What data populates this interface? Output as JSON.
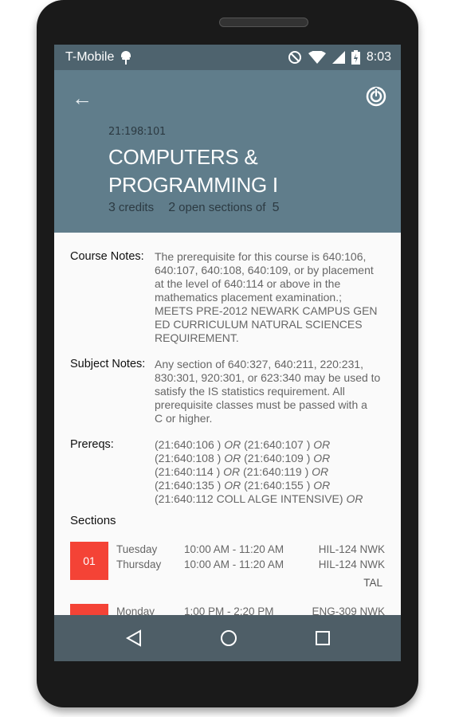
{
  "status_bar": {
    "carrier": "T-Mobile",
    "time": "8:03"
  },
  "header": {
    "course_code": "21:198:101",
    "title_lines": [
      "COMPUTERS &",
      "PROGRAMMING I"
    ],
    "credits": "3",
    "credits_label": "credits",
    "open_sections": "2",
    "open_label": "open sections of",
    "total_sections": "5",
    "color": "#607d8b"
  },
  "notes": {
    "course_label": "Course Notes:",
    "course_lines": [
      "The prerequisite for this course is 640:106,",
      "640:107, 640:108, 640:109, or by placement",
      "at the level of 640:114 or above in the",
      "mathematics placement examination.;",
      "MEETS PRE-2012 NEWARK CAMPUS GEN",
      "ED CURRICULUM NATURAL SCIENCES",
      "REQUIREMENT."
    ],
    "subject_label": "Subject Notes:",
    "subject_lines": [
      "Any section of 640:327, 640:211, 220:231,",
      "830:301, 920:301, or 623:340 may be used to",
      "satisfy the IS statistics requirement. All",
      "prerequisite classes must be passed with a",
      "C or higher."
    ],
    "prereqs_label": "Prereqs:",
    "prereq_lines": [
      [
        "(21:640:106 )",
        "OR",
        "(21:640:107 )",
        "OR"
      ],
      [
        "(21:640:108 )",
        "OR",
        "(21:640:109 )",
        "OR"
      ],
      [
        "(21:640:114 )",
        "OR",
        "(21:640:119 )",
        "OR"
      ],
      [
        "(21:640:135 )",
        "OR",
        "(21:640:155 )",
        "OR"
      ],
      [
        "(21:640:112 COLL ALGE INTENSIVE)",
        "OR",
        "",
        ""
      ]
    ]
  },
  "sections": {
    "heading": "Sections",
    "items": [
      {
        "number": "01",
        "meetings": [
          {
            "day": "Tuesday",
            "time": "10:00 AM - 11:20 AM",
            "room": "HIL-124 NWK"
          },
          {
            "day": "Thursday",
            "time": "10:00 AM - 11:20 AM",
            "room": "HIL-124 NWK"
          }
        ],
        "instructor": "TAL"
      },
      {
        "number": "",
        "meetings": [
          {
            "day": "Monday",
            "time": "1:00 PM - 2:20 PM",
            "room": "ENG-309 NWK"
          }
        ],
        "instructor": ""
      }
    ],
    "badge_color": "#f44336"
  }
}
